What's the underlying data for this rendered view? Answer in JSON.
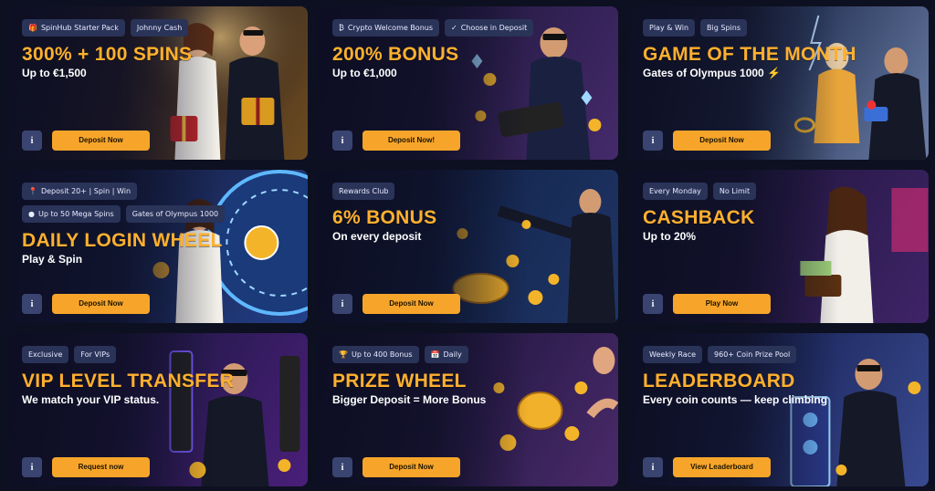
{
  "promos": [
    {
      "tags": [
        {
          "icon": "gift-icon",
          "glyph": "🎁",
          "label": "SpinHub Starter Pack"
        },
        {
          "label": "Johnny Cash"
        }
      ],
      "title": "300% + 100 SPINS",
      "subtitle": "Up to €1,500",
      "cta": "Deposit Now",
      "theme": "casino-hall"
    },
    {
      "tags": [
        {
          "icon": "bitcoin-icon",
          "glyph": "₿",
          "label": "Crypto Welcome Bonus"
        },
        {
          "icon": "check-icon",
          "glyph": "✓",
          "label": "Choose in Deposit"
        }
      ],
      "title": "200% BONUS",
      "subtitle": "Up to €1,000",
      "cta": "Deposit Now!",
      "theme": "crypto"
    },
    {
      "tags": [
        {
          "label": "Play & Win"
        },
        {
          "label": "Big Spins"
        }
      ],
      "title": "GAME OF THE MONTH",
      "subtitle": "Gates of Olympus 1000 ⚡",
      "cta": "Deposit Now",
      "theme": "olympus"
    },
    {
      "tags": [
        {
          "icon": "pin-icon",
          "glyph": "📍",
          "label": "Deposit 20+ | Spin | Win"
        },
        {
          "icon": "coin-icon",
          "glyph": "●",
          "label": "Up to 50 Mega Spins"
        },
        {
          "label": "Gates of Olympus 1000"
        }
      ],
      "title": "DAILY LOGIN WHEEL",
      "subtitle": "Play & Spin",
      "cta": "Deposit Now",
      "theme": "wheel"
    },
    {
      "tags": [
        {
          "label": "Rewards Club"
        }
      ],
      "title": "6% BONUS",
      "subtitle": "On every deposit",
      "cta": "Deposit Now",
      "theme": "coins"
    },
    {
      "tags": [
        {
          "label": "Every Monday"
        },
        {
          "label": "No Limit"
        }
      ],
      "title": "CASHBACK",
      "subtitle": "Up to 20%",
      "cta": "Play Now",
      "theme": "cashback"
    },
    {
      "tags": [
        {
          "label": "Exclusive"
        },
        {
          "label": "For VIPs"
        }
      ],
      "title": "VIP LEVEL TRANSFER",
      "subtitle": "We match your VIP status.",
      "cta": "Request now",
      "theme": "vip"
    },
    {
      "tags": [
        {
          "icon": "trophy-icon",
          "glyph": "🏆",
          "label": "Up to 400 Bonus"
        },
        {
          "icon": "calendar-icon",
          "glyph": "📅",
          "label": "Daily"
        }
      ],
      "title": "PRIZE WHEEL",
      "subtitle": "Bigger Deposit = More Bonus",
      "cta": "Deposit Now",
      "theme": "prize"
    },
    {
      "tags": [
        {
          "label": "Weekly Race"
        },
        {
          "label": "960+ Coin Prize Pool"
        }
      ],
      "title": "LEADERBOARD",
      "subtitle": "Every coin counts — keep climbing",
      "cta": "View Leaderboard",
      "theme": "leader"
    }
  ],
  "info_label": "i",
  "colors": {
    "accent": "#f7a52a",
    "title": "#ffb02e",
    "tag_bg": "#2a3358",
    "info_bg": "#3a4470",
    "page_bg": "#0d1020"
  }
}
